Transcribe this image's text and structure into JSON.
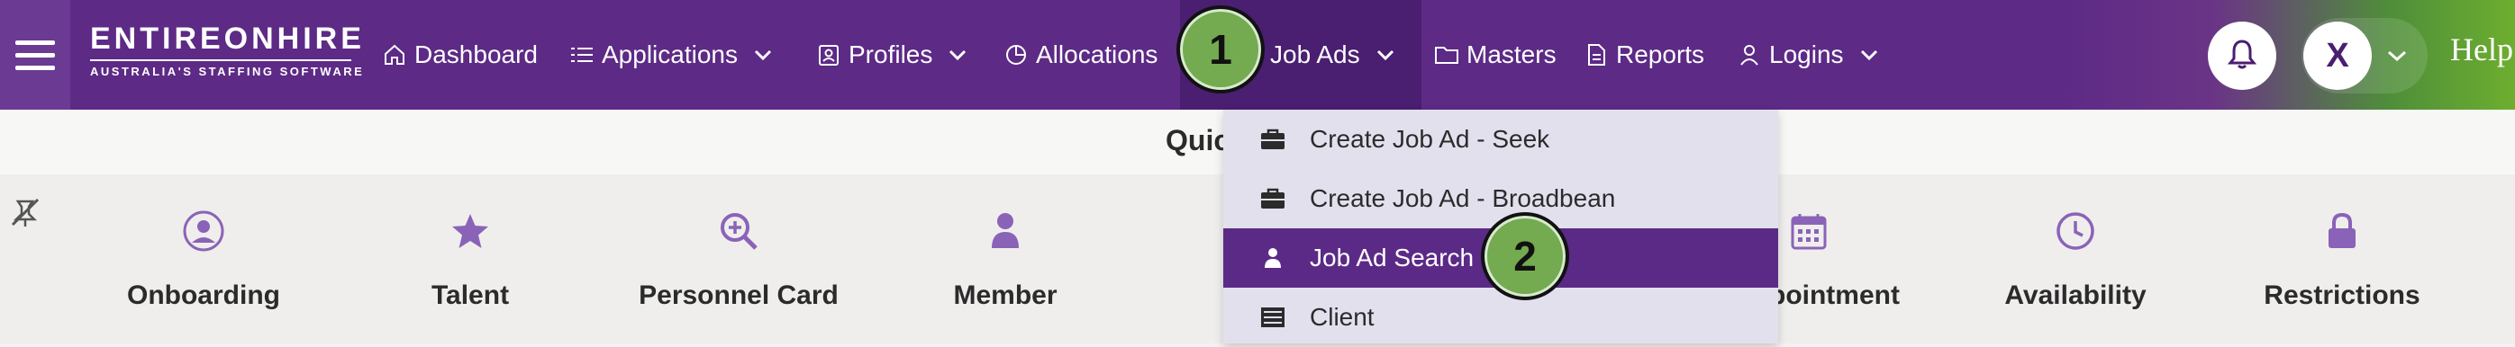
{
  "brand": {
    "name": "ENTIREONHIRE",
    "tagline": "AUSTRALIA'S STAFFING SOFTWARE"
  },
  "nav": {
    "dashboard": "Dashboard",
    "applications": "Applications",
    "profiles": "Profiles",
    "allocations": "Allocations",
    "job_ads": "Job Ads",
    "masters": "Masters",
    "reports": "Reports",
    "logins": "Logins"
  },
  "user": {
    "initial": "X"
  },
  "help_label": "Help",
  "quick": {
    "title": "Quic",
    "items": [
      "Onboarding",
      "Talent",
      "Personnel Card",
      "Member",
      "pointment",
      "Availability",
      "Restrictions"
    ]
  },
  "dropdown": {
    "items": [
      "Create Job Ad - Seek",
      "Create Job Ad - Broadbean",
      "Job Ad Search",
      "Client"
    ],
    "selected": "Job Ad Search"
  },
  "markers": [
    "1",
    "2"
  ],
  "colors": {
    "primary": "#5d2a86",
    "accent_green": "#6dae2f",
    "marker": "#74aa50",
    "icon_purple": "#8a63b8"
  }
}
